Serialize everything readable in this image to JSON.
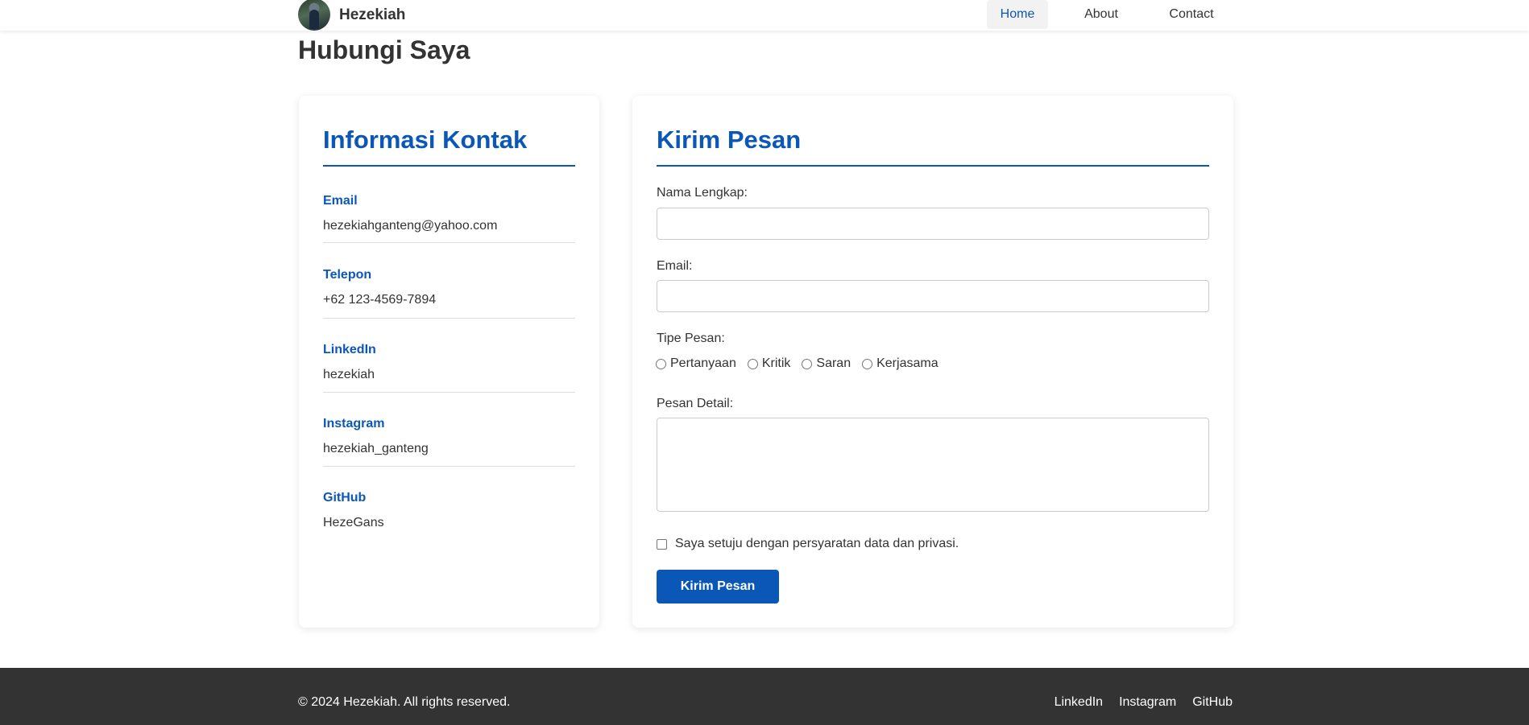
{
  "header": {
    "brand_name": "Hezekiah",
    "nav": [
      {
        "label": "Home",
        "active": true
      },
      {
        "label": "About",
        "active": false
      },
      {
        "label": "Contact",
        "active": false
      }
    ]
  },
  "page": {
    "title": "Hubungi Saya"
  },
  "contact_info": {
    "title": "Informasi Kontak",
    "items": [
      {
        "label": "Email",
        "value": "hezekiahganteng@yahoo.com"
      },
      {
        "label": "Telepon",
        "value": "+62 123-4569-7894"
      },
      {
        "label": "LinkedIn",
        "value": "hezekiah"
      },
      {
        "label": "Instagram",
        "value": "hezekiah_ganteng"
      },
      {
        "label": "GitHub",
        "value": "HezeGans"
      }
    ]
  },
  "form": {
    "title": "Kirim Pesan",
    "name_label": "Nama Lengkap:",
    "name_value": "",
    "email_label": "Email:",
    "email_value": "",
    "type_label": "Tipe Pesan:",
    "type_options": [
      "Pertanyaan",
      "Kritik",
      "Saran",
      "Kerjasama"
    ],
    "detail_label": "Pesan Detail:",
    "detail_value": "",
    "agree_label": "Saya setuju dengan persyaratan data dan privasi.",
    "submit_label": "Kirim Pesan"
  },
  "footer": {
    "copyright": "© 2024 Hezekiah. All rights reserved.",
    "links": [
      "LinkedIn",
      "Instagram",
      "GitHub"
    ]
  },
  "colors": {
    "accent": "#0b57b8",
    "text": "#333333",
    "footer_bg": "#333333"
  }
}
